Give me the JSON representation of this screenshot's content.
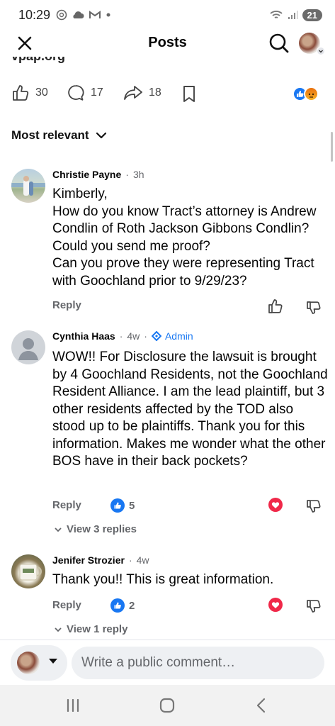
{
  "status_bar": {
    "time": "10:29",
    "battery": "21"
  },
  "header": {
    "title": "Posts"
  },
  "link_preview": {
    "domain_clipped": "vpap.org"
  },
  "post_actions": {
    "like_count": "30",
    "comment_count": "17",
    "share_count": "18"
  },
  "sort": {
    "label": "Most relevant"
  },
  "comments": [
    {
      "name": "Christie Payne",
      "time": "3h",
      "text": "Kimberly,\nHow do you know Tract’s attorney is Andrew Condlin of Roth Jackson Gibbons Condlin? Could you send me proof?\nCan you prove they were representing Tract with Goochland prior to 9/29/23?",
      "reply_label": "Reply"
    },
    {
      "name": "Cynthia Haas",
      "time": "4w",
      "badge": "Admin",
      "text": "WOW!! For Disclosure the lawsuit is brought by 4 Goochland Residents, not the Goochland Resident Alliance. I am the lead plaintiff, but 3 other residents affected by the TOD also stood up to be plaintiffs. Thank you for this information. Makes me wonder what the other BOS have in their back pockets?",
      "reply_label": "Reply",
      "like_count": "5",
      "view_replies": "View 3 replies"
    },
    {
      "name": "Jenifer Strozier",
      "time": "4w",
      "text": "Thank you!! This is great information.",
      "reply_label": "Reply",
      "like_count": "2",
      "view_replies": "View 1 reply"
    }
  ],
  "composer": {
    "placeholder": "Write a public comment…"
  },
  "colors": {
    "accent": "#1877f2",
    "heart": "#f02849",
    "secondary_text": "#65676b"
  }
}
